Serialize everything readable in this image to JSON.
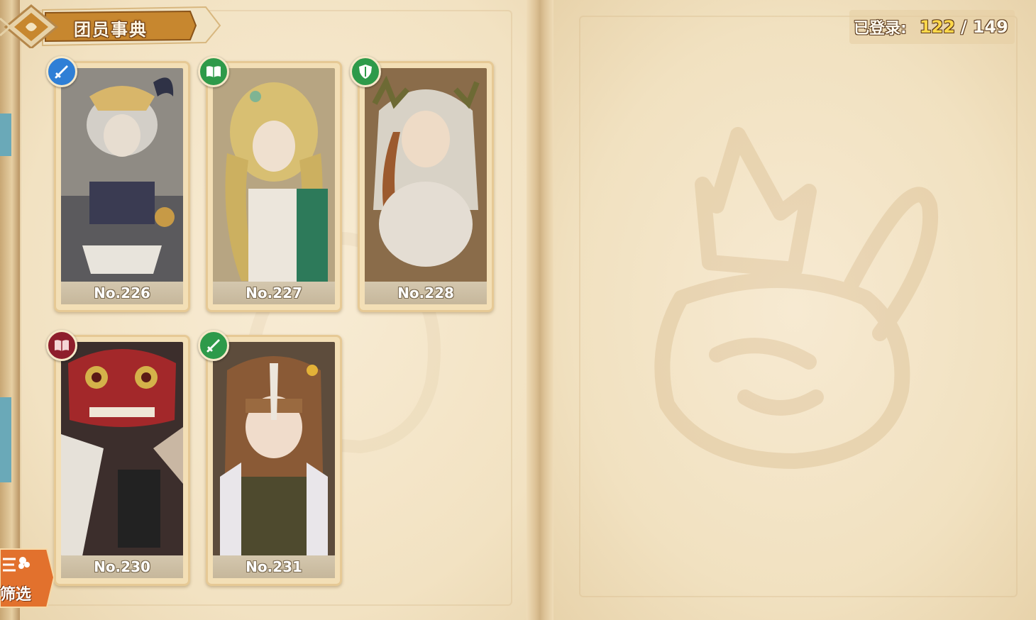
{
  "header": {
    "title": "团员事典"
  },
  "counter": {
    "label": "已登录:",
    "registered": "122",
    "separator": "/",
    "total": "149"
  },
  "cards": [
    {
      "number": "No.226",
      "class_icon": "sword-icon",
      "badge_color": "#2f7fd6"
    },
    {
      "number": "No.227",
      "class_icon": "book-icon",
      "badge_color": "#2e9a4a"
    },
    {
      "number": "No.228",
      "class_icon": "shield-icon",
      "badge_color": "#2e9a4a"
    },
    {
      "number": "No.230",
      "class_icon": "book-icon",
      "badge_color": "#8e1e2c"
    },
    {
      "number": "No.231",
      "class_icon": "sword-icon",
      "badge_color": "#2e9a4a"
    }
  ],
  "filter": {
    "label": "筛选",
    "icon": "filter-icon"
  }
}
